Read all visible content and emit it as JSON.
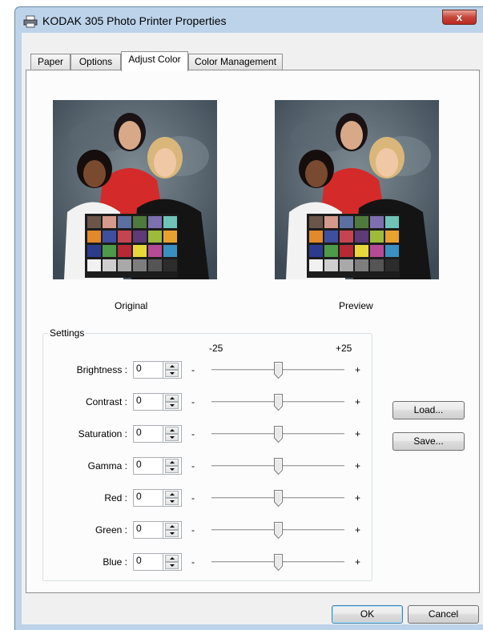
{
  "window": {
    "title": "KODAK 305 Photo Printer Properties",
    "close_label": "x"
  },
  "tabs": [
    {
      "label": "Paper"
    },
    {
      "label": "Options"
    },
    {
      "label": "Adjust Color",
      "active": true
    },
    {
      "label": "Color Management"
    }
  ],
  "images": {
    "original_caption": "Original",
    "preview_caption": "Preview",
    "chart_colors": [
      "#6a5548",
      "#d59a8b",
      "#5b6fa0",
      "#4f7a3e",
      "#7d6fb0",
      "#6fc3b7",
      "#e2892c",
      "#3f4fa0",
      "#c5444f",
      "#5d3a78",
      "#9dba3b",
      "#e7a22d",
      "#2d3b8e",
      "#4d9a48",
      "#b72a35",
      "#e6d83c",
      "#b44b96",
      "#3a8fc1",
      "#f1f1f1",
      "#cfcfcf",
      "#a9a9a9",
      "#7e7e7e",
      "#555555",
      "#2c2c2c"
    ]
  },
  "settings": {
    "group_label": "Settings",
    "scale_min_label": "-25",
    "scale_max_label": "+25",
    "minus": "-",
    "plus": "+",
    "rows": [
      {
        "label": "Brightness :",
        "value": "0",
        "slider": 0
      },
      {
        "label": "Contrast :",
        "value": "0",
        "slider": 0
      },
      {
        "label": "Saturation :",
        "value": "0",
        "slider": 0
      },
      {
        "label": "Gamma :",
        "value": "0",
        "slider": 0
      },
      {
        "label": "Red :",
        "value": "0",
        "slider": 0
      },
      {
        "label": "Green :",
        "value": "0",
        "slider": 0
      },
      {
        "label": "Blue :",
        "value": "0",
        "slider": 0
      }
    ]
  },
  "buttons": {
    "load": "Load...",
    "save": "Save...",
    "ok": "OK",
    "cancel": "Cancel"
  }
}
